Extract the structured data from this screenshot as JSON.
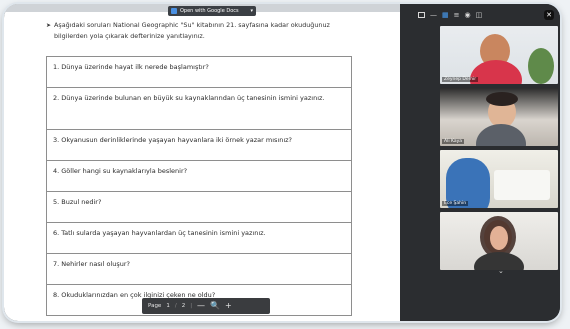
{
  "doc": {
    "opener_label": "Open with Google Docs",
    "intro": "Aşağıdaki soruları National Geographic \"Su\" kitabının 21. sayfasına kadar okuduğunuz bilgilerden yola çıkarak defterinize yanıtlayınız.",
    "questions": [
      "1. Dünya üzerinde hayat ilk nerede başlamıştır?",
      "2. Dünya üzerinde bulunan en büyük su kaynaklarından üç tanesinin ismini yazınız.",
      "3. Okyanusun derinliklerinde yaşayan hayvanlara iki örnek yazar mısınız?",
      "4. Göller hangi su kaynaklarıyla beslenir?",
      "5. Buzul nedir?",
      "6. Tatlı sularda yaşayan hayvanlardan üç tanesinin ismini yazınız.",
      "7. Nehirler nasıl oluşur?",
      "8. Okuduklarınızdan en çok ilginizi çeken ne oldu?"
    ],
    "page_toolbar": {
      "page_label": "Page",
      "current_page": "1",
      "separator": "/",
      "total_pages": "2",
      "zoom_out": "—",
      "zoom_in": "+"
    }
  },
  "meeting": {
    "participants": [
      {
        "name": "Zeynep Demir"
      },
      {
        "name": "Ali Kaya"
      },
      {
        "name": "Ece Şahin"
      },
      {
        "name": ""
      }
    ],
    "colors": {
      "panel": "#2b2d30",
      "accent": "#49a3ff"
    }
  }
}
